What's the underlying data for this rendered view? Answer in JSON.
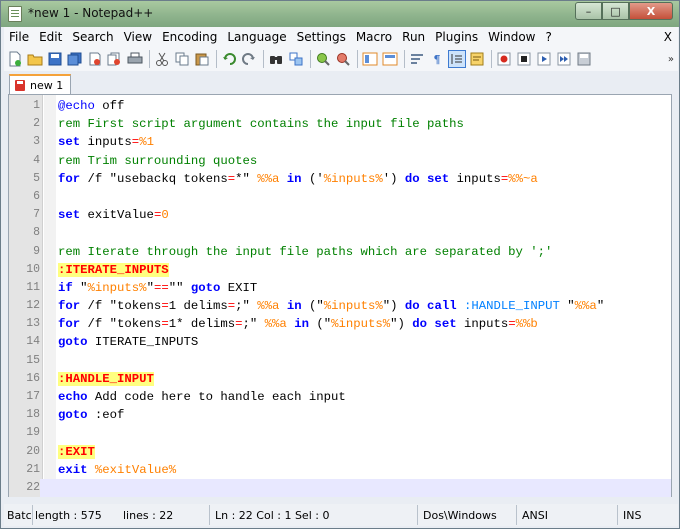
{
  "window": {
    "title": "*new  1 - Notepad++"
  },
  "caption": {
    "minimize": "–",
    "maximize": "□",
    "close": "X"
  },
  "menu": [
    "File",
    "Edit",
    "Search",
    "View",
    "Encoding",
    "Language",
    "Settings",
    "Macro",
    "Run",
    "Plugins",
    "Window",
    "?"
  ],
  "menu_close_doc": "X",
  "toolbar": {
    "icons": [
      "new-file-icon",
      "open-file-icon",
      "save-icon",
      "save-all-icon",
      "close-icon",
      "close-all-icon",
      "print-icon",
      "cut-icon",
      "copy-icon",
      "paste-icon",
      "undo-icon",
      "redo-icon",
      "find-icon",
      "replace-icon",
      "zoom-in-icon",
      "zoom-out-icon",
      "sync-vertical-icon",
      "sync-horizontal-icon",
      "word-wrap-icon",
      "show-all-chars-icon",
      "indent-guide-icon",
      "user-language-icon",
      "record-macro-icon",
      "stop-macro-icon",
      "play-macro-icon",
      "run-macro-multiple-icon",
      "save-macro-icon"
    ],
    "overflow": "»"
  },
  "tabs": [
    {
      "label": "new  1"
    }
  ],
  "editor": {
    "lines": [
      {
        "n": "1",
        "tokens": [
          [
            "kw",
            "@echo"
          ],
          [
            "str",
            " off"
          ]
        ]
      },
      {
        "n": "2",
        "tokens": [
          [
            "cm",
            "rem First script argument contains the input file paths"
          ]
        ]
      },
      {
        "n": "3",
        "tokens": [
          [
            "kw",
            "set"
          ],
          [
            "str",
            " inputs"
          ],
          [
            "op",
            "="
          ],
          [
            "var",
            "%1"
          ]
        ]
      },
      {
        "n": "4",
        "tokens": [
          [
            "cm",
            "rem Trim surrounding quotes"
          ]
        ]
      },
      {
        "n": "5",
        "tokens": [
          [
            "kw",
            "for"
          ],
          [
            "str",
            " /f \"usebackq tokens"
          ],
          [
            "op",
            "="
          ],
          [
            "str",
            "*\" "
          ],
          [
            "var",
            "%%a"
          ],
          [
            "str",
            " "
          ],
          [
            "kw",
            "in"
          ],
          [
            "str",
            " ('"
          ],
          [
            "var",
            "%inputs%"
          ],
          [
            "str",
            "') "
          ],
          [
            "kw",
            "do set"
          ],
          [
            "str",
            " inputs"
          ],
          [
            "op",
            "="
          ],
          [
            "var",
            "%%~a"
          ]
        ]
      },
      {
        "n": "6",
        "tokens": []
      },
      {
        "n": "7",
        "tokens": [
          [
            "kw",
            "set"
          ],
          [
            "str",
            " exitValue"
          ],
          [
            "op",
            "="
          ],
          [
            "var",
            "0"
          ]
        ]
      },
      {
        "n": "8",
        "tokens": []
      },
      {
        "n": "9",
        "tokens": [
          [
            "cm",
            "rem Iterate through the input file paths which are separated by ';'"
          ]
        ]
      },
      {
        "n": "10",
        "tokens": [
          [
            "lbl",
            ":ITERATE_INPUTS"
          ]
        ]
      },
      {
        "n": "11",
        "tokens": [
          [
            "kw",
            "if"
          ],
          [
            "str",
            " \""
          ],
          [
            "var",
            "%inputs%"
          ],
          [
            "str",
            "\""
          ],
          [
            "op",
            "=="
          ],
          [
            "str",
            "\"\" "
          ],
          [
            "kw",
            "goto"
          ],
          [
            "str",
            " EXIT"
          ]
        ]
      },
      {
        "n": "12",
        "tokens": [
          [
            "kw",
            "for"
          ],
          [
            "str",
            " /f \"tokens"
          ],
          [
            "op",
            "="
          ],
          [
            "str",
            "1 delims"
          ],
          [
            "op",
            "="
          ],
          [
            "str",
            ";\" "
          ],
          [
            "var",
            "%%a"
          ],
          [
            "str",
            " "
          ],
          [
            "kw",
            "in"
          ],
          [
            "str",
            " (\""
          ],
          [
            "var",
            "%inputs%"
          ],
          [
            "str",
            "\") "
          ],
          [
            "kw",
            "do call"
          ],
          [
            "str",
            " "
          ],
          [
            "call",
            ":HANDLE_INPUT"
          ],
          [
            "str",
            " \""
          ],
          [
            "var",
            "%%a"
          ],
          [
            "str",
            "\""
          ]
        ]
      },
      {
        "n": "13",
        "tokens": [
          [
            "kw",
            "for"
          ],
          [
            "str",
            " /f \"tokens"
          ],
          [
            "op",
            "="
          ],
          [
            "str",
            "1* delims"
          ],
          [
            "op",
            "="
          ],
          [
            "str",
            ";\" "
          ],
          [
            "var",
            "%%a"
          ],
          [
            "str",
            " "
          ],
          [
            "kw",
            "in"
          ],
          [
            "str",
            " (\""
          ],
          [
            "var",
            "%inputs%"
          ],
          [
            "str",
            "\") "
          ],
          [
            "kw",
            "do set"
          ],
          [
            "str",
            " inputs"
          ],
          [
            "op",
            "="
          ],
          [
            "var",
            "%%b"
          ]
        ]
      },
      {
        "n": "14",
        "tokens": [
          [
            "kw",
            "goto"
          ],
          [
            "str",
            " ITERATE_INPUTS"
          ]
        ]
      },
      {
        "n": "15",
        "tokens": []
      },
      {
        "n": "16",
        "tokens": [
          [
            "lbl",
            ":HANDLE_INPUT"
          ]
        ]
      },
      {
        "n": "17",
        "tokens": [
          [
            "kw",
            "echo"
          ],
          [
            "str",
            " Add code here to handle each input"
          ]
        ]
      },
      {
        "n": "18",
        "tokens": [
          [
            "kw",
            "goto"
          ],
          [
            "str",
            " :eof"
          ]
        ]
      },
      {
        "n": "19",
        "tokens": []
      },
      {
        "n": "20",
        "tokens": [
          [
            "lbl",
            ":EXIT"
          ]
        ]
      },
      {
        "n": "21",
        "tokens": [
          [
            "kw",
            "exit"
          ],
          [
            "str",
            " "
          ],
          [
            "var",
            "%exitValue%"
          ]
        ]
      },
      {
        "n": "22",
        "tokens": []
      }
    ],
    "current_line": "22"
  },
  "status": {
    "file_type": "Batc",
    "length": "length : 575",
    "lines": "lines : 22",
    "position": "Ln : 22   Col : 1   Sel : 0",
    "eol": "Dos\\Windows",
    "encoding": "ANSI",
    "mode": "INS"
  },
  "colors": {
    "keyword": "#0000ff",
    "comment": "#008000",
    "operator": "#ff0000",
    "variable": "#ff8000",
    "label": "#ff0000",
    "label_bg": "#ffff80",
    "current_line_bg": "#e8e8ff",
    "title_bar": "#8fb48d"
  }
}
